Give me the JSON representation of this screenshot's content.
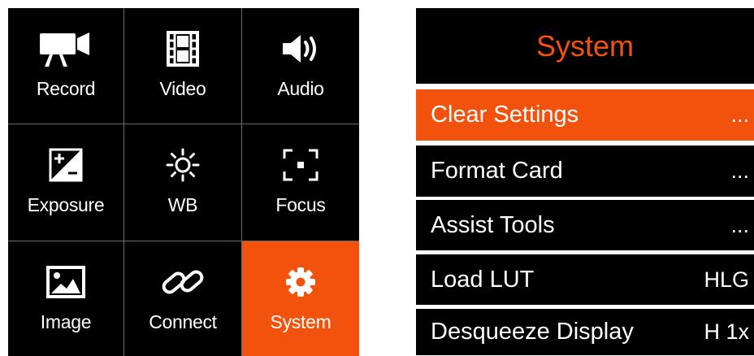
{
  "menu_grid": {
    "items": [
      {
        "label": "Record",
        "icon": "video-camera-icon"
      },
      {
        "label": "Video",
        "icon": "film-icon"
      },
      {
        "label": "Audio",
        "icon": "speaker-icon"
      },
      {
        "label": "Exposure",
        "icon": "exposure-icon"
      },
      {
        "label": "WB",
        "icon": "sun-icon"
      },
      {
        "label": "Focus",
        "icon": "focus-frame-icon"
      },
      {
        "label": "Image",
        "icon": "image-icon"
      },
      {
        "label": "Connect",
        "icon": "link-icon"
      },
      {
        "label": "System",
        "icon": "gear-icon"
      }
    ],
    "selected": "System"
  },
  "system_panel": {
    "title": "System",
    "rows": [
      {
        "label": "Clear Settings",
        "value": "..."
      },
      {
        "label": "Format Card",
        "value": "..."
      },
      {
        "label": "Assist Tools",
        "value": "..."
      },
      {
        "label": "Load LUT",
        "value": "HLG"
      },
      {
        "label": "Desqueeze Display",
        "value": "H 1x"
      }
    ]
  },
  "colors": {
    "accent": "#f2520c",
    "background": "#000000",
    "text": "#ffffff",
    "divider": "#6b6b6b"
  }
}
